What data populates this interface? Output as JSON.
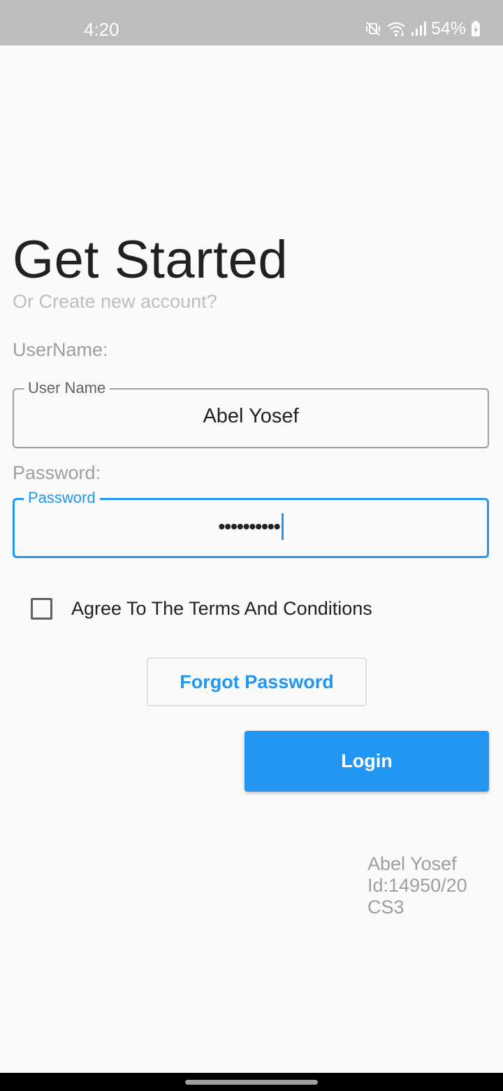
{
  "status_bar": {
    "time": "4:20",
    "battery_percent": "54%",
    "icons": [
      "mute-vibrate-icon",
      "wifi-icon",
      "signal-icon",
      "battery-charging-icon"
    ]
  },
  "header": {
    "title": "Get Started",
    "subtitle": "Or Create new account?"
  },
  "form": {
    "username": {
      "caption": "UserName:",
      "label": "User Name",
      "value": "Abel Yosef"
    },
    "password": {
      "caption": "Password:",
      "label": "Password",
      "value": "••••••••••",
      "focused": true
    },
    "terms": {
      "label": "Agree To The Terms And Conditions",
      "checked": false
    },
    "forgot_label": "Forgot Password",
    "login_label": "Login"
  },
  "footer_info": {
    "name": "Abel Yosef",
    "id": "Id:14950/20",
    "section": "CS3"
  },
  "colors": {
    "accent": "#2196f3",
    "status_bar": "#bdbdbd",
    "background": "#fafafa"
  }
}
